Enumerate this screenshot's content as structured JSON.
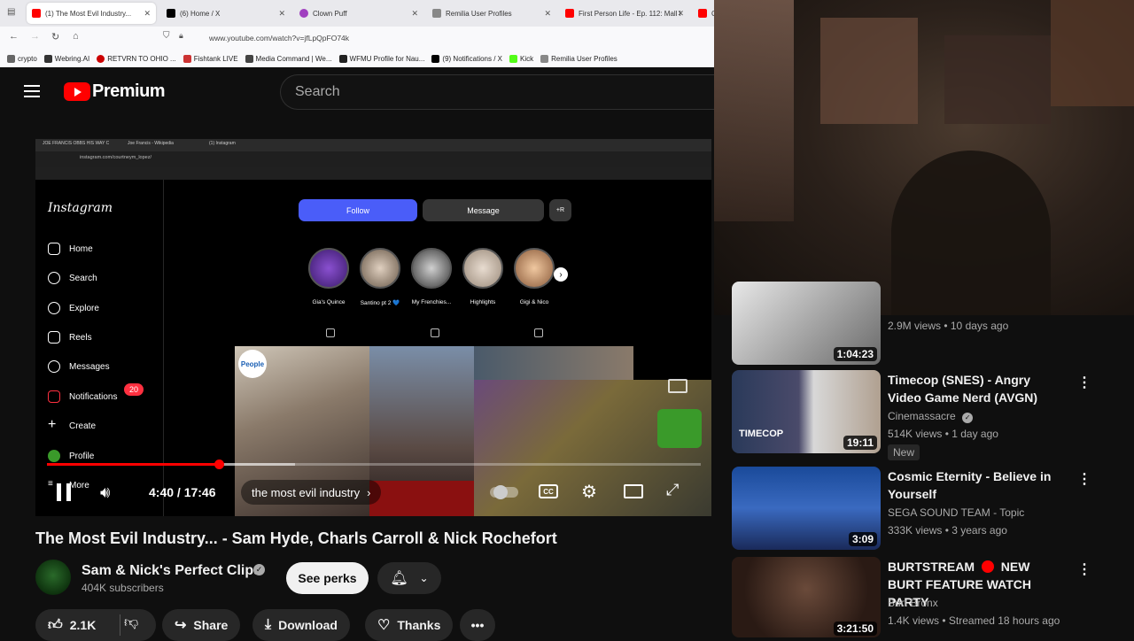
{
  "browser": {
    "tabs": [
      {
        "label": "(1) The Most Evil Industry...",
        "color": "#ff0000"
      },
      {
        "label": "(6) Home / X",
        "color": "#000000"
      },
      {
        "label": "Clown Puff",
        "color": "#a040c0"
      },
      {
        "label": "Remilia User Profiles",
        "color": "#888888"
      },
      {
        "label": "First Person Life - Ep. 112: Mall I",
        "color": "#ff0000"
      },
      {
        "label": "C",
        "color": "#ff0000"
      }
    ],
    "url": "www.youtube.com/watch?v=jfLpQpFO74k",
    "bookmarks": [
      {
        "label": "crypto",
        "color": "#666666"
      },
      {
        "label": "Webring.AI",
        "color": "#333333"
      },
      {
        "label": "RETVRN TO OHIO ...",
        "color": "#cc0000"
      },
      {
        "label": "Fishtank LIVE",
        "color": "#cc3333"
      },
      {
        "label": "Media Command | We...",
        "color": "#444444"
      },
      {
        "label": "WFMU Profile for Nau...",
        "color": "#222222"
      },
      {
        "label": "(9) Notifications / X",
        "color": "#000000"
      },
      {
        "label": "Kick",
        "color": "#53fc18"
      },
      {
        "label": "Remilia User Profiles",
        "color": "#888888"
      }
    ]
  },
  "youtube": {
    "logo_text": "Premium",
    "search_placeholder": "Search"
  },
  "video_frame": {
    "inner_tabs": [
      "JOE FRANCIS OBBS HIS WAY C",
      "Joe Francis - Wikipedia",
      "(1) Instagram"
    ],
    "inner_url": "instagram.com/courtneym_lopez/",
    "instagram": {
      "logo": "Instagram",
      "nav": [
        "Home",
        "Search",
        "Explore",
        "Reels",
        "Messages",
        "Notifications",
        "Create",
        "Profile",
        "More"
      ],
      "notif_count": "20",
      "follow": "Follow",
      "message": "Message",
      "add_user": "+R",
      "stories": [
        "Gia's Quince",
        "Santino pt 2 💙",
        "My Frenchies...",
        "Highlights",
        "Gigi & Nico"
      ],
      "people_logo": "People"
    }
  },
  "player": {
    "time": "4:40 / 17:46",
    "chapter": "the most evil industry",
    "progress_fraction": 0.263,
    "buffer_fraction": 0.38,
    "cc": "CC"
  },
  "video": {
    "title": "The Most Evil Industry... - Sam Hyde, Charls Carroll & Nick Rochefort",
    "channel": "Sam & Nick's Perfect Clips",
    "subscribers": "404K subscribers",
    "see_perks": "See perks",
    "likes": "2.1K",
    "share": "Share",
    "download": "Download",
    "thanks": "Thanks"
  },
  "recommended": [
    {
      "title": "",
      "channel": "",
      "meta": "2.9M views • 10 days ago",
      "duration": "1:04:23"
    },
    {
      "title": "Timecop (SNES) - Angry Video Game Nerd (AVGN)",
      "channel": "Cinemassacre",
      "meta": "514K views • 1 day ago",
      "duration": "19:11",
      "badge": "New",
      "thumb_text": "TIMECOP"
    },
    {
      "title": "Cosmic Eternity - Believe in Yourself",
      "channel": "SEGA SOUND TEAM - Topic",
      "meta": "333K views • 3 years ago",
      "duration": "3:09"
    },
    {
      "title_a": "BURTSTREAM",
      "title_b": "NEW BURT FEATURE WATCH PARTY",
      "channel": "Burt Bronx",
      "meta": "1.4K views • Streamed 18 hours ago",
      "duration": "3:21:50"
    }
  ]
}
